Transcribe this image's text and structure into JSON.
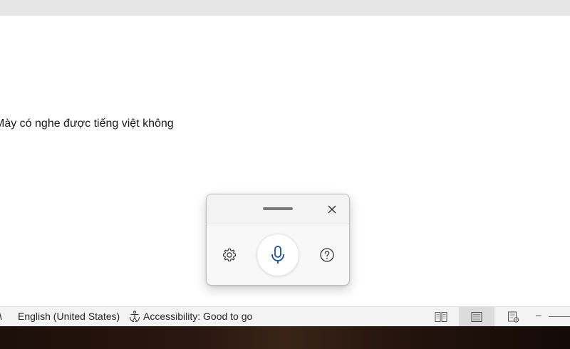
{
  "document": {
    "text": "Mày có nghe được tiếng việt không"
  },
  "dictation": {
    "icons": {
      "drag": "drag-handle",
      "close": "close-icon",
      "settings": "gear-icon",
      "mic": "microphone-icon",
      "help": "question-mark-icon"
    },
    "accent": "#1e4e8c"
  },
  "status_bar": {
    "language": "English (United States)",
    "accessibility": "Accessibility: Good to go",
    "views": [
      "read-mode-icon",
      "print-layout-icon",
      "web-layout-icon"
    ],
    "active_view": "print-layout"
  },
  "colors": {
    "status_bar_bg": "#f3f3f3",
    "active_view_bg": "#dcdcdc",
    "mic_icon": "#1e4e8c"
  }
}
